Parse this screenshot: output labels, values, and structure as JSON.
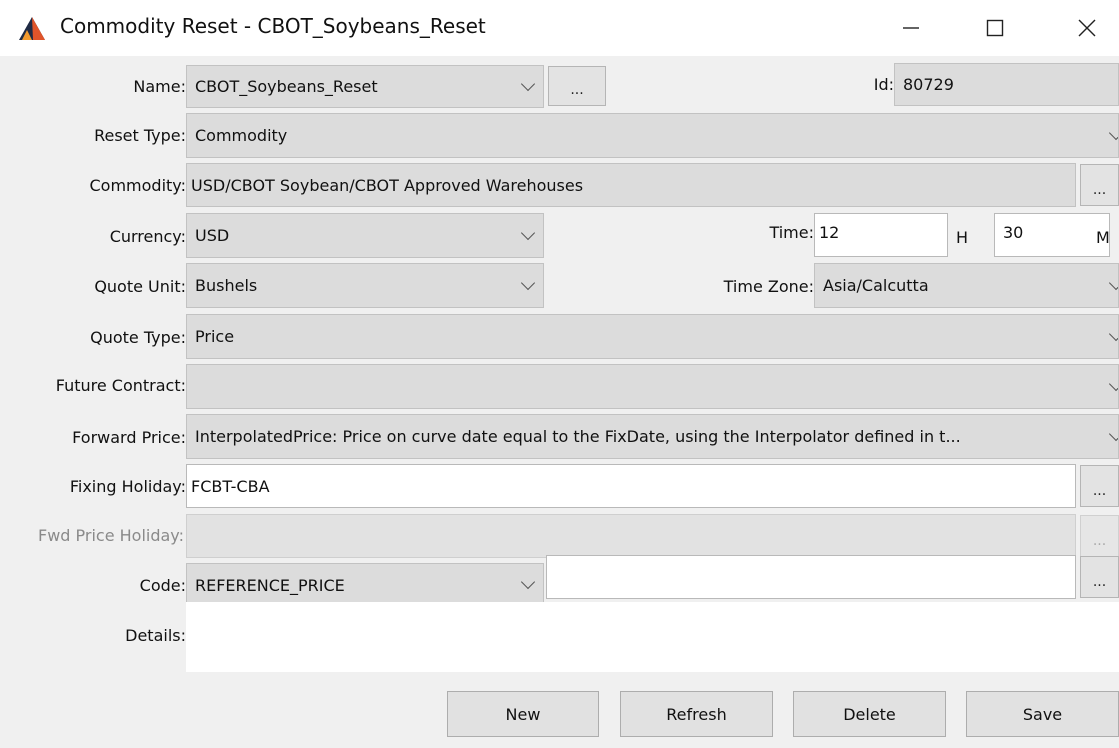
{
  "window": {
    "title": "Commodity Reset - CBOT_Soybeans_Reset",
    "icon": "app-logo-icon",
    "controls": {
      "minimize": "—",
      "maximize": "☐",
      "close": "✕"
    }
  },
  "form": {
    "name": {
      "label": "Name:",
      "value": "CBOT_Soybeans_Reset",
      "more": "..."
    },
    "id": {
      "label": "Id:",
      "value": "80729"
    },
    "reset_type": {
      "label": "Reset Type:",
      "value": "Commodity"
    },
    "commodity": {
      "label": "Commodity:",
      "value": "USD/CBOT Soybean/CBOT Approved Warehouses",
      "more": "..."
    },
    "currency": {
      "label": "Currency:",
      "value": "USD"
    },
    "time": {
      "label": "Time:",
      "hours": "12",
      "hours_unit": "H",
      "minutes": "30",
      "minutes_unit": "M"
    },
    "quote_unit": {
      "label": "Quote Unit:",
      "value": "Bushels"
    },
    "time_zone": {
      "label": "Time Zone:",
      "value": "Asia/Calcutta"
    },
    "quote_type": {
      "label": "Quote Type:",
      "value": "Price"
    },
    "future_contract": {
      "label": "Future Contract:",
      "value": ""
    },
    "forward_price": {
      "label": "Forward Price:",
      "value": "InterpolatedPrice: Price on curve date equal to the FixDate, using the Interpolator defined in t..."
    },
    "fixing_holiday": {
      "label": "Fixing Holiday:",
      "value": "FCBT-CBA",
      "more": "..."
    },
    "fwd_price_holiday": {
      "label": "Fwd Price Holiday:",
      "value": "",
      "more": "..."
    },
    "code": {
      "label": "Code:",
      "value": "REFERENCE_PRICE",
      "text": "",
      "more": "..."
    },
    "details": {
      "label": "Details:",
      "value": ""
    }
  },
  "buttons": {
    "new": "New",
    "refresh": "Refresh",
    "delete": "Delete",
    "save": "Save"
  }
}
